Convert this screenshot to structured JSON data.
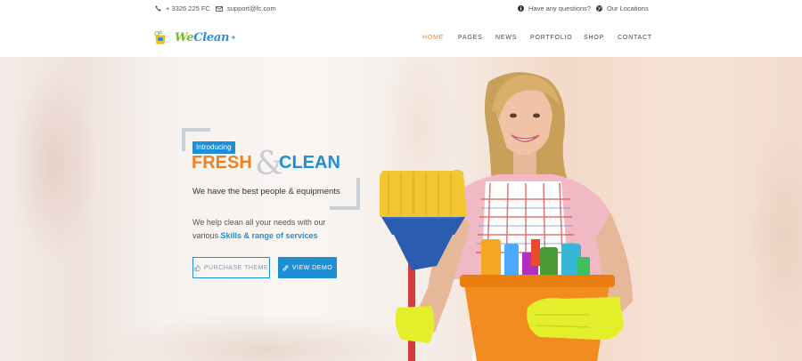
{
  "topbar": {
    "phone": "+ 3326 225 FC",
    "email": "support@fc.com",
    "question": "Have any questions?",
    "locations": "Our Locations"
  },
  "logo": {
    "part1": "We",
    "part2": "Clean"
  },
  "nav": [
    "HOME",
    "PAGES",
    "NEWS",
    "PORTFOLIO",
    "SHOP",
    "CONTACT"
  ],
  "hero": {
    "badge": "Introducing",
    "title_word1": "FRESH",
    "title_amp": "&",
    "title_word2": "CLEAN",
    "tagline": "We have the best people & equipments",
    "desc_line1": "We help clean all your needs with our",
    "desc_line2_prefix": "various ",
    "desc_highlight": "Skills & range of services",
    "btn_purchase": "PURCHASE THEME",
    "btn_demo": "VIEW DEMO"
  },
  "colors": {
    "accent_blue": "#1e8fd5",
    "accent_orange": "#ee7f22",
    "nav_active": "#e08a2a"
  },
  "icons": [
    "phone-icon",
    "mail-icon",
    "info-icon",
    "globe-icon",
    "thumbs-up-icon",
    "link-icon"
  ]
}
